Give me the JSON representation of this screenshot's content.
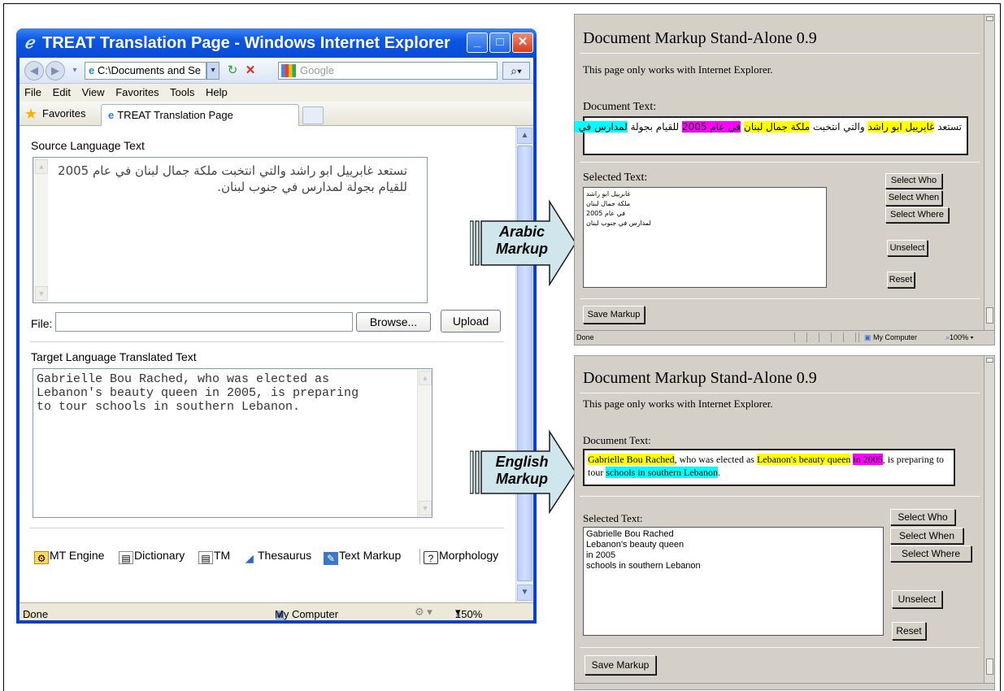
{
  "ie_window": {
    "title": "TREAT Translation Page - Windows Internet Explorer",
    "address": "C:\\Documents and Se",
    "search_placeholder": "Google",
    "menu": [
      "File",
      "Edit",
      "View",
      "Favorites",
      "Tools",
      "Help"
    ],
    "favorites_label": "Favorites",
    "tab_label": "TREAT Translation Page",
    "source_label": "Source Language Text",
    "source_text": "تستعد غابرييل ابو راشد والتي انتخبت ملكة جمال لبنان في عام 2005 للقيام بجولة لمدارس في جنوب لبنان.",
    "file_label": "File:",
    "browse_label": "Browse...",
    "upload_label": "Upload",
    "target_label": "Target Language Translated Text",
    "target_text": "Gabrielle Bou Rached, who was elected as\nLebanon's beauty queen in 2005, is preparing\nto tour schools in southern Lebanon.",
    "tools": [
      "MT Engine",
      "Dictionary",
      "TM",
      "Thesaurus",
      "Text Markup",
      "Morphology"
    ],
    "status_done": "Done",
    "status_zone": "My Computer",
    "zoom": "150%"
  },
  "arrows": [
    {
      "line1": "Arabic",
      "line2": "Markup"
    },
    {
      "line1": "English",
      "line2": "Markup"
    }
  ],
  "arabic_panel": {
    "title": "Document Markup Stand-Alone 0.9",
    "notice": "This page only works with Internet Explorer.",
    "doc_label": "Document Text:",
    "doc_segments": [
      {
        "text": "تستعد ",
        "hl": ""
      },
      {
        "text": "غابرييل ابو راشد",
        "hl": "y"
      },
      {
        "text": " والتي انتخبت ",
        "hl": ""
      },
      {
        "text": "ملكة جمال لبنان",
        "hl": "y"
      },
      {
        "text": " ",
        "hl": ""
      },
      {
        "text": "في عام 2005",
        "hl": "m"
      },
      {
        "text": " للقيام بجولة ",
        "hl": ""
      },
      {
        "text": "لمدارس في جنوب لبنان",
        "hl": "c"
      },
      {
        "text": ".",
        "hl": ""
      }
    ],
    "selected_label": "Selected Text:",
    "selected_items": [
      "غابرييل ابو راشد",
      "ملكة جمال لبنان",
      "في عام 2005",
      "لمدارس في جنوب لبنان"
    ],
    "buttons": {
      "who": "Select Who",
      "when": "Select When",
      "where": "Select Where",
      "unselect": "Unselect",
      "reset": "Reset",
      "save": "Save Markup"
    },
    "status_done": "Done",
    "status_zone": "My Computer",
    "zoom": "100%"
  },
  "english_panel": {
    "title": "Document Markup Stand-Alone 0.9",
    "notice": "This page only works with Internet Explorer.",
    "doc_label": "Document Text:",
    "doc_segments": [
      {
        "text": "Gabrielle Bou Rached",
        "hl": "y"
      },
      {
        "text": ", who was elected as ",
        "hl": ""
      },
      {
        "text": "Lebanon's beauty queen",
        "hl": "y"
      },
      {
        "text": " ",
        "hl": ""
      },
      {
        "text": "in 2005",
        "hl": "m"
      },
      {
        "text": ", is preparing to tour ",
        "hl": ""
      },
      {
        "text": "schools in southern Lebanon",
        "hl": "c"
      },
      {
        "text": ".",
        "hl": ""
      }
    ],
    "selected_label": "Selected Text:",
    "selected_items": [
      "Gabrielle Bou Rached",
      "Lebanon's beauty queen",
      "in 2005",
      "schools in southern Lebanon"
    ],
    "buttons": {
      "who": "Select Who",
      "when": "Select When",
      "where": "Select Where",
      "unselect": "Unselect",
      "reset": "Reset",
      "save": "Save Markup"
    }
  },
  "colors": {
    "who": "#ffff00",
    "when": "#ff00ff",
    "where": "#00ffff",
    "ie_blue": "#0a4bd6"
  }
}
